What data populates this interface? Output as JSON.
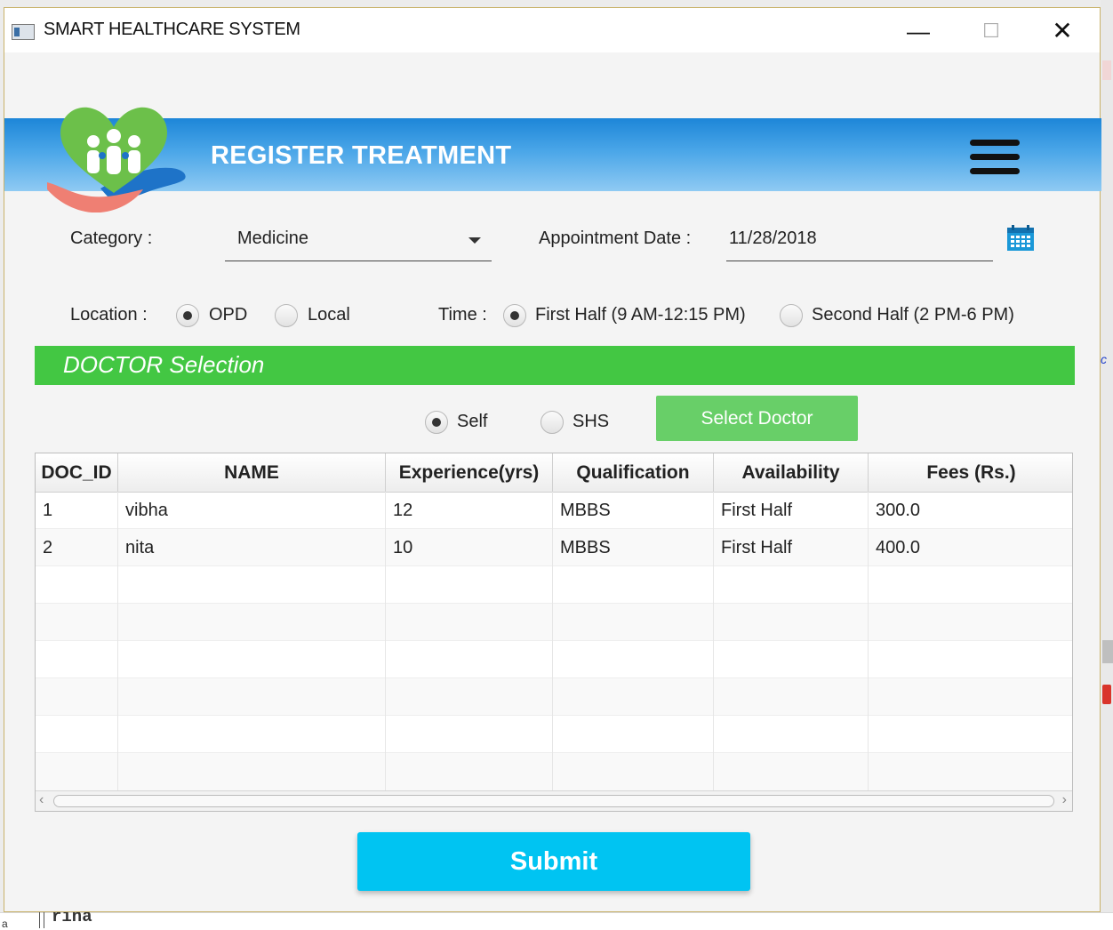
{
  "window": {
    "title": "SMART HEALTHCARE SYSTEM",
    "min_glyph": "—",
    "max_glyph": "☐",
    "close_glyph": "✕"
  },
  "header": {
    "title": "REGISTER TREATMENT",
    "menu_icon": "hamburger-icon",
    "logo_icon": "heart-hands-logo"
  },
  "form": {
    "category_label": "Category :",
    "category_value": "Medicine",
    "appointment_label": "Appointment Date :",
    "appointment_value": "11/28/2018",
    "location_label": "Location :",
    "location_options": [
      "OPD",
      "Local"
    ],
    "location_selected": "OPD",
    "time_label": "Time :",
    "time_options": [
      "First Half (9 AM-12:15 PM)",
      "Second Half (2 PM-6 PM)"
    ],
    "time_selected": "First Half (9 AM-12:15 PM)"
  },
  "doctor_section": {
    "title": "DOCTOR Selection",
    "source_options": [
      "Self",
      "SHS"
    ],
    "source_selected": "Self",
    "select_button": "Select Doctor"
  },
  "table": {
    "columns": [
      "DOC_ID",
      "NAME",
      "Experience(yrs)",
      "Qualification",
      "Availability",
      "Fees (Rs.)"
    ],
    "rows": [
      [
        "1",
        "vibha",
        "12",
        "MBBS",
        "First Half",
        "300.0"
      ],
      [
        "2",
        "nita",
        "10",
        "MBBS",
        "First Half",
        "400.0"
      ]
    ]
  },
  "submit_label": "Submit",
  "background": {
    "bottom_text": "rina",
    "left_letter": "a",
    "right_letter": "c"
  },
  "colors": {
    "header_blue": "#1d86d8",
    "section_green": "#43c743",
    "select_green": "#68cf68",
    "submit_cyan": "#00c4f2"
  }
}
